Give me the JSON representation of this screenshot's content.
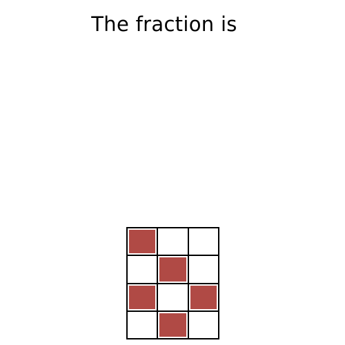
{
  "title": "The fraction is",
  "grid": {
    "rows": 4,
    "cols": 3,
    "shaded_color": "#b04a45",
    "unshaded_color": "#ffffff",
    "cells": [
      [
        true,
        false,
        false
      ],
      [
        false,
        true,
        false
      ],
      [
        true,
        false,
        true
      ],
      [
        false,
        true,
        false
      ]
    ],
    "shaded_count": 5,
    "total_count": 12
  }
}
